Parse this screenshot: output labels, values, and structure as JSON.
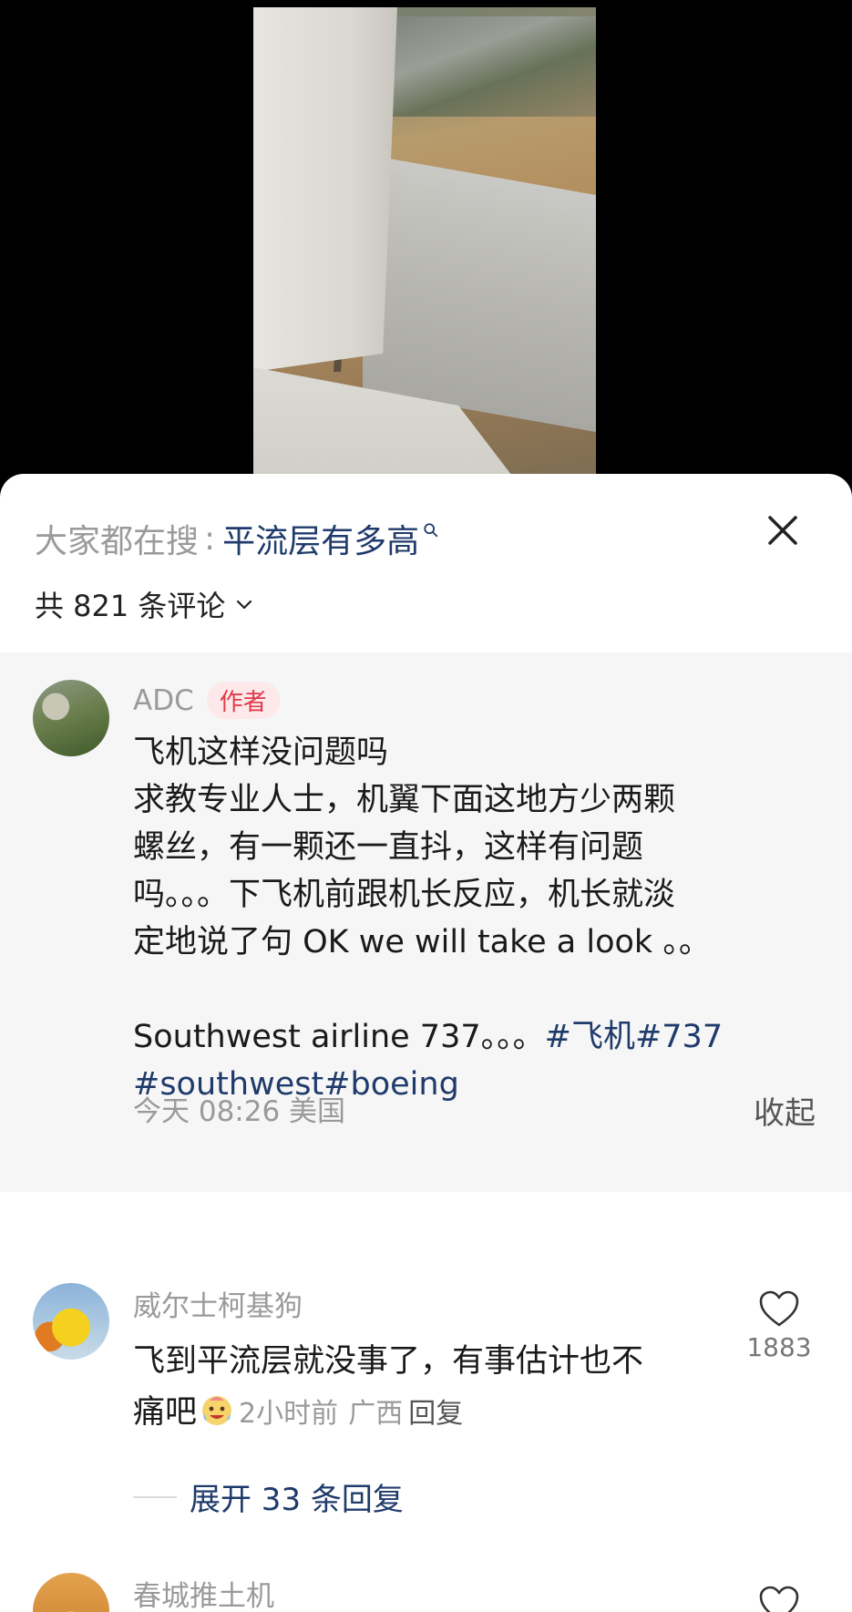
{
  "search_bar": {
    "prefix": "大家都在搜",
    "separator": ":",
    "term": "平流层有多高"
  },
  "comments_header": {
    "count_text": "共 821 条评论"
  },
  "pinned_comment": {
    "user": "ADC",
    "badge": "作者",
    "lines": [
      "飞机这样没问题吗",
      "求教专业人士，机翼下面这地方少两颗",
      "螺丝，有一颗还一直抖，这样有问题",
      "吗。。。下飞机前跟机长反应，机长就淡",
      "定地说了句 OK we will take a look 。。"
    ],
    "line_after_blank": "Southwest airline 737。。。",
    "tags_inline": "#飞机#737",
    "tags_next_line": "#southwest#boeing",
    "meta": "今天 08:26 美国",
    "collapse_label": "收起"
  },
  "comments": [
    {
      "user": "威尔士柯基狗",
      "text_line1": "飞到平流层就没事了，有事估计也不",
      "text_line2": "痛吧",
      "emoji": "crying-laughing-emoji",
      "time": "2小时前",
      "location": "广西",
      "reply_label": "回复",
      "likes": "1883",
      "expand_label": "展开 33 条回复"
    },
    {
      "user": "春城推土机"
    }
  ],
  "colors": {
    "link_blue": "#1f3b6b",
    "author_badge_red": "#e2394a",
    "muted_gray": "#9a9a9a",
    "pinned_bg": "#f6f6f6"
  },
  "icons": {
    "close": "close-icon",
    "chevron": "chevron-down-icon",
    "like": "heart-outline-icon",
    "search_hint": "search-icon"
  }
}
